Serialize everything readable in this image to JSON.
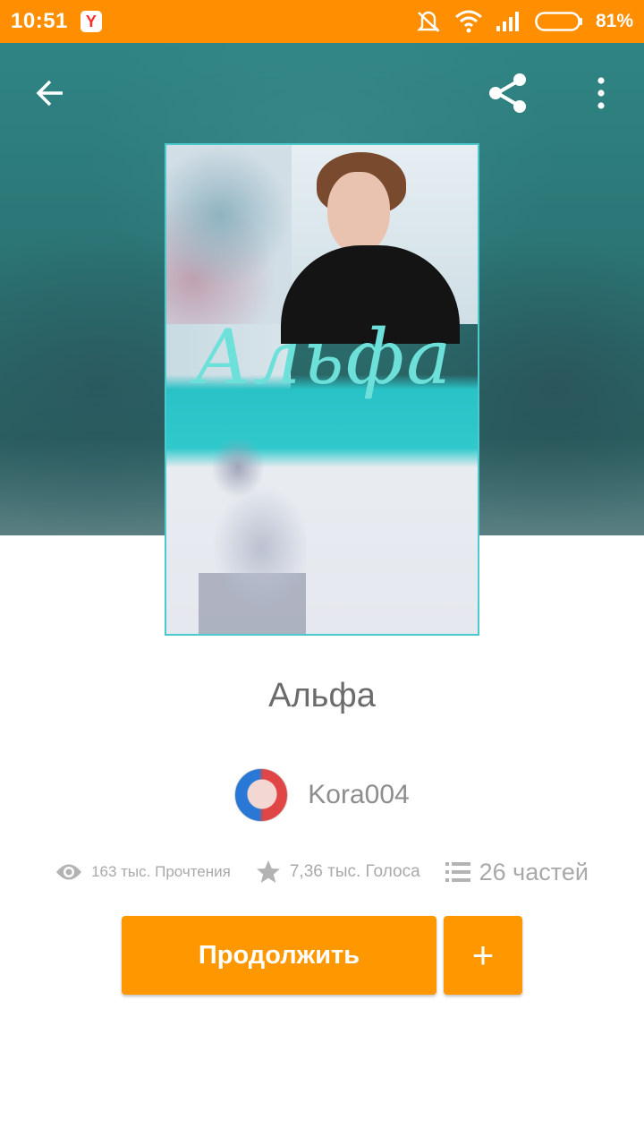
{
  "status_bar": {
    "time": "10:51",
    "app_badge": "Y",
    "battery": "81%",
    "icons": [
      "muted-icon",
      "wifi-icon",
      "signal-icon",
      "battery-icon"
    ]
  },
  "header": {
    "back_icon": "back-arrow-icon",
    "share_icon": "share-icon",
    "more_icon": "more-vertical-icon"
  },
  "cover": {
    "title": "Альфа"
  },
  "book": {
    "title": "Альфа",
    "author": "Kora004",
    "stats": {
      "reads": "163 тыс. Прочтения",
      "votes": "7,36 тыс. Голоса",
      "parts": "26 частей"
    }
  },
  "actions": {
    "continue_label": "Продолжить",
    "add_label": "+"
  },
  "colors": {
    "accent": "#ff9800",
    "status_bar": "#ff8f00",
    "hero": "#2c7676"
  }
}
